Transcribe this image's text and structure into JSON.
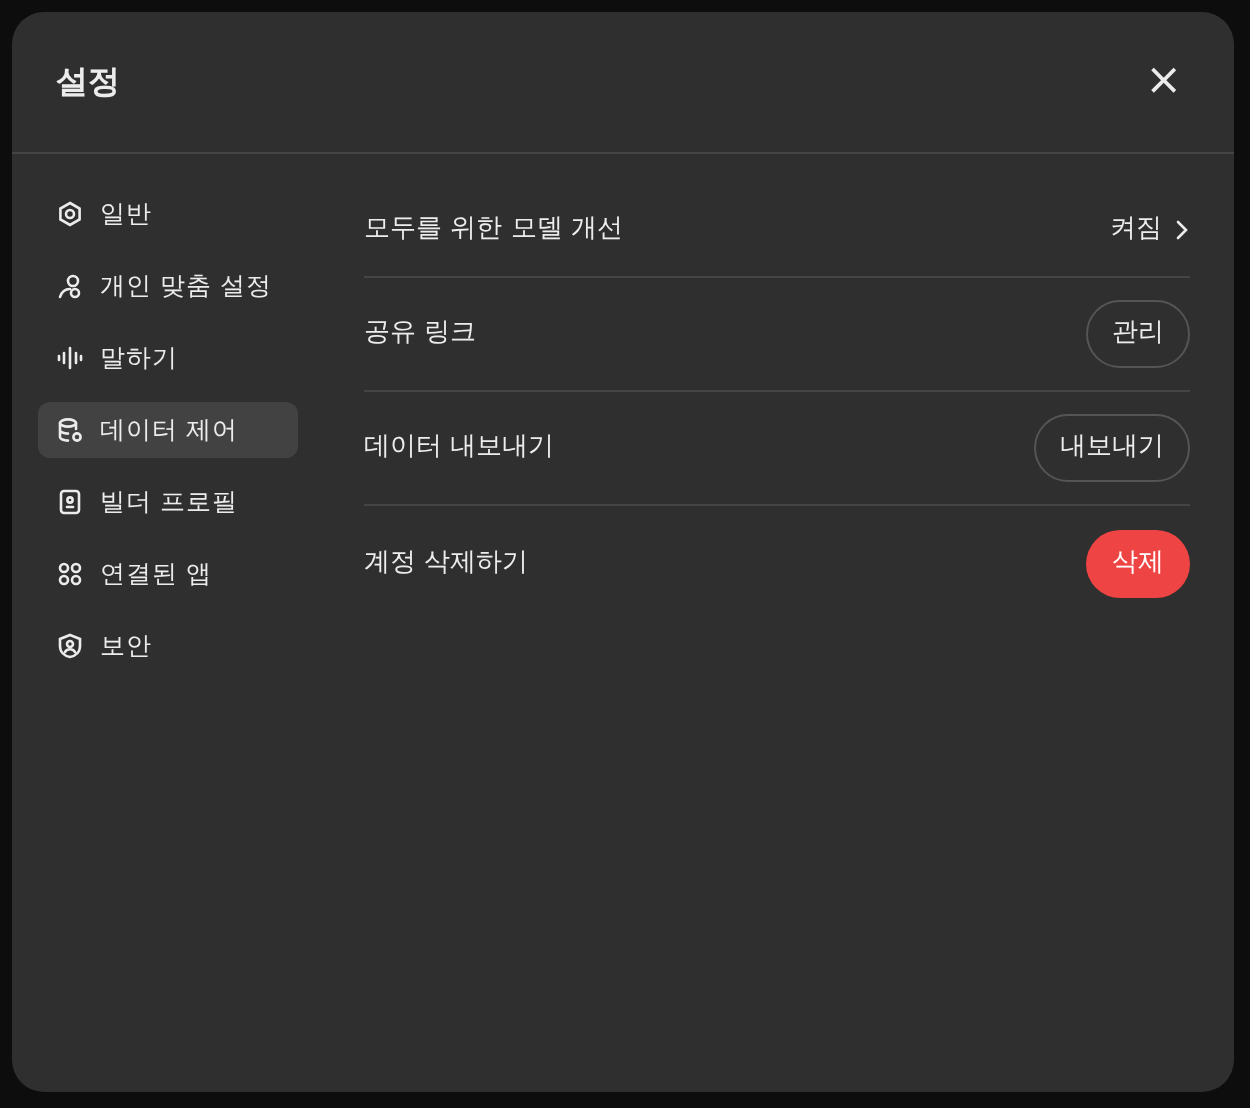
{
  "dialog": {
    "title": "설정",
    "close": "×"
  },
  "sidebar": {
    "items": [
      {
        "label": "일반",
        "selected": false
      },
      {
        "label": "개인 맞춤 설정",
        "selected": false
      },
      {
        "label": "말하기",
        "selected": false
      },
      {
        "label": "데이터 제어",
        "selected": true
      },
      {
        "label": "빌더 프로필",
        "selected": false
      },
      {
        "label": "연결된 앱",
        "selected": false
      },
      {
        "label": "보안",
        "selected": false
      }
    ]
  },
  "settings": [
    {
      "kind": "link",
      "label": "모두를 위한 모델 개선",
      "value": "켜짐"
    },
    {
      "kind": "button",
      "label": "공유 링크",
      "action": "관리"
    },
    {
      "kind": "button",
      "label": "데이터 내보내기",
      "action": "내보내기"
    },
    {
      "kind": "danger",
      "label": "계정 삭제하기",
      "action": "삭제"
    }
  ]
}
